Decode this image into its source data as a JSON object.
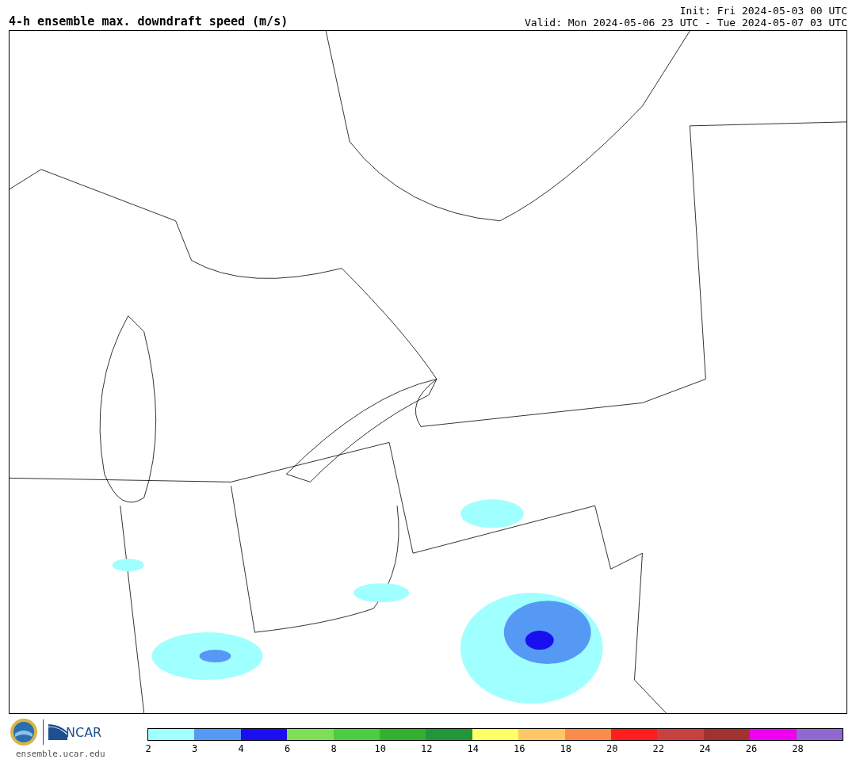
{
  "header": {
    "title": "4-h ensemble max. downdraft speed (m/s)",
    "init": "Init: Fri 2024-05-03 00 UTC",
    "valid": "Valid: Mon 2024-05-06 23 UTC - Tue 2024-05-07 03 UTC"
  },
  "footer": {
    "logo_text": "NCAR",
    "site": "ensemble.ucar.edu"
  },
  "legend": {
    "bins": [
      {
        "label": "2",
        "color": "#a0ffff"
      },
      {
        "label": "3",
        "color": "#5599f5"
      },
      {
        "label": "4",
        "color": "#1a0ff0"
      },
      {
        "label": "6",
        "color": "#7ddf55"
      },
      {
        "label": "8",
        "color": "#4ccc40"
      },
      {
        "label": "10",
        "color": "#33b030"
      },
      {
        "label": "12",
        "color": "#21963a"
      },
      {
        "label": "14",
        "color": "#ffff66"
      },
      {
        "label": "16",
        "color": "#ffc866"
      },
      {
        "label": "18",
        "color": "#fa8c4b"
      },
      {
        "label": "20",
        "color": "#ff1e1e"
      },
      {
        "label": "22",
        "color": "#c84040"
      },
      {
        "label": "24",
        "color": "#a03232"
      },
      {
        "label": "26",
        "color": "#f000f0"
      },
      {
        "label": "28",
        "color": "#9068d0"
      }
    ]
  }
}
